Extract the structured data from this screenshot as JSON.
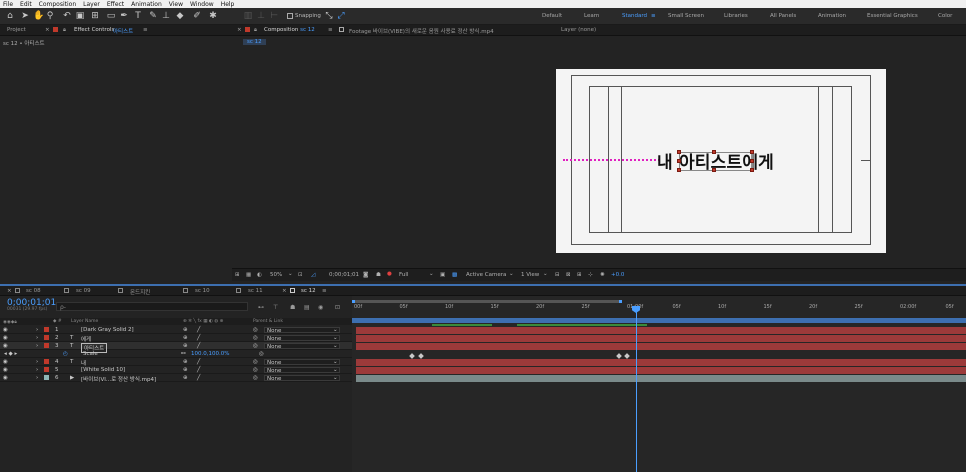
{
  "menu": [
    "File",
    "Edit",
    "Composition",
    "Layer",
    "Effect",
    "Animation",
    "View",
    "Window",
    "Help"
  ],
  "toolbar": {
    "snapping_label": "Snapping",
    "workspaces": [
      "Default",
      "Learn",
      "Standard",
      "Small Screen",
      "Libraries",
      "All Panels",
      "Animation",
      "Essential Graphics",
      "Color"
    ],
    "active_workspace": "Standard"
  },
  "left_panel": {
    "tab_project": "Project",
    "tab_effect_controls": "Effect Controls",
    "effect_target": "아티스트",
    "breadcrumb": "sc 12 • 아티스트"
  },
  "comp_panel": {
    "tab_composition": "Composition",
    "comp_name": "sc 12",
    "footage_tab": "Footage 바이브(VIBE)의 새로운 음원 사용료 정산 방식.mp4",
    "layer_tab": "Layer (none)",
    "subtab": "sc 12",
    "title_text": "내 아티스트에게"
  },
  "comp_footer": {
    "zoom": "50%",
    "timecode": "0;00;01;01",
    "resolution": "Full",
    "camera": "Active Camera",
    "views": "1 View",
    "exposure": "+0.0"
  },
  "timeline": {
    "tabs": [
      "sc 08",
      "sc 09",
      "몬드지킨",
      "sc 10",
      "sc 11",
      "sc 12"
    ],
    "current_tab": "sc 12",
    "timecode": "0;00;01;01",
    "frame_info": "00031 (29.97 fps)",
    "search_placeholder": "ρ-",
    "col_layer_name": "Layer Name",
    "col_parent": "Parent & Link",
    "ruler_labels": [
      "00f",
      "05f",
      "10f",
      "15f",
      "20f",
      "25f",
      "01:00f",
      "05f",
      "10f",
      "15f",
      "20f",
      "25f",
      "02:00f",
      "05f"
    ],
    "layers": [
      {
        "num": "1",
        "type": "",
        "name": "[Dark Gray Solid 2]",
        "color": "#c0392b",
        "parent": "None"
      },
      {
        "num": "2",
        "type": "T",
        "name": "에게",
        "color": "#c0392b",
        "parent": "None"
      },
      {
        "num": "3",
        "type": "T",
        "name": "아티스트",
        "color": "#c0392b",
        "parent": "None"
      },
      {
        "num": "4",
        "type": "T",
        "name": "내",
        "color": "#c0392b",
        "parent": "None"
      },
      {
        "num": "5",
        "type": "",
        "name": "[White Solid 10]",
        "color": "#c0392b",
        "parent": "None"
      },
      {
        "num": "6",
        "type": "▶",
        "name": "[바이브(VI...로 정산 방식.mp4]",
        "color": "#8fb7b7",
        "parent": "None"
      }
    ],
    "scale_prop": {
      "label": "Scale",
      "value": "100.0,100.0%"
    },
    "colors": {
      "accent": "#4a9eff",
      "layer_bar": "#9c3a3a",
      "video_bar": "#7a8a8a",
      "playhead": "#4a9eff"
    }
  }
}
